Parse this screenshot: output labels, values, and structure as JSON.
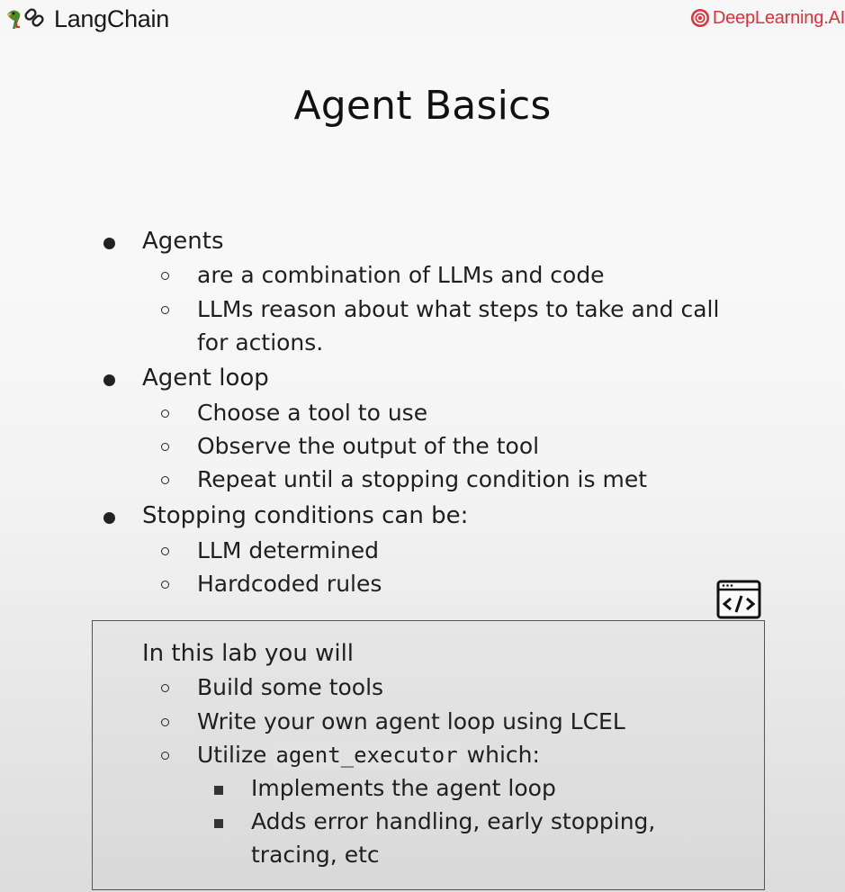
{
  "header": {
    "left_brand": "LangChain",
    "right_brand": "DeepLearning.AI",
    "left_icon": "parrot-chain-logo",
    "right_icon": "deeplearning-ai-logo",
    "brand_color": "#e0303a"
  },
  "slide": {
    "title": "Agent Basics",
    "sections": [
      {
        "heading": "Agents",
        "items": [
          "are a combination of LLMs and code",
          "LLMs reason about what steps to take and call",
          "for actions."
        ]
      },
      {
        "heading": "Agent loop",
        "items": [
          "Choose a tool to use",
          "Observe the output of the tool",
          "Repeat until a stopping condition is met"
        ]
      },
      {
        "heading": "Stopping conditions can be:",
        "items": [
          "LLM determined",
          "Hardcoded rules"
        ]
      }
    ],
    "lab": {
      "icon": "code-window-icon",
      "heading": "In this lab you will",
      "items": [
        "Build some tools",
        "Write your own agent loop using LCEL"
      ],
      "utilize_prefix": "Utilize",
      "utilize_code": "agent_executor",
      "utilize_suffix": "which:",
      "subitems": [
        "Implements the agent loop",
        "Adds error handling, early stopping,",
        "tracing, etc"
      ]
    }
  }
}
